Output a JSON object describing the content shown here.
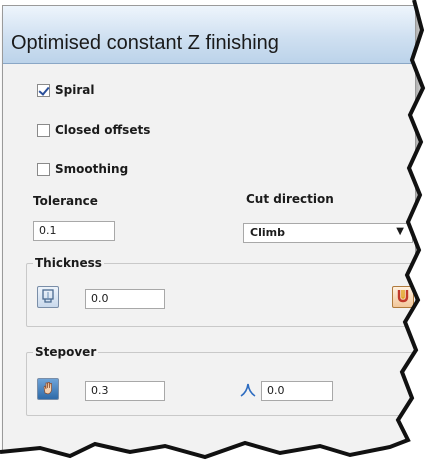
{
  "dialog": {
    "title": "Optimised constant Z finishing"
  },
  "options": {
    "spiral": {
      "label": "Spiral",
      "checked": true
    },
    "closed_offsets": {
      "label": "Closed offsets",
      "checked": false
    },
    "smoothing": {
      "label": "Smoothing",
      "checked": false
    }
  },
  "tolerance": {
    "label": "Tolerance",
    "value": "0.1"
  },
  "cut_direction": {
    "label": "Cut direction",
    "selected": "Climb"
  },
  "thickness": {
    "label": "Thickness",
    "value": "0.0"
  },
  "stepover": {
    "label": "Stepover",
    "value": "0.3",
    "cusp_value": "0.0"
  }
}
